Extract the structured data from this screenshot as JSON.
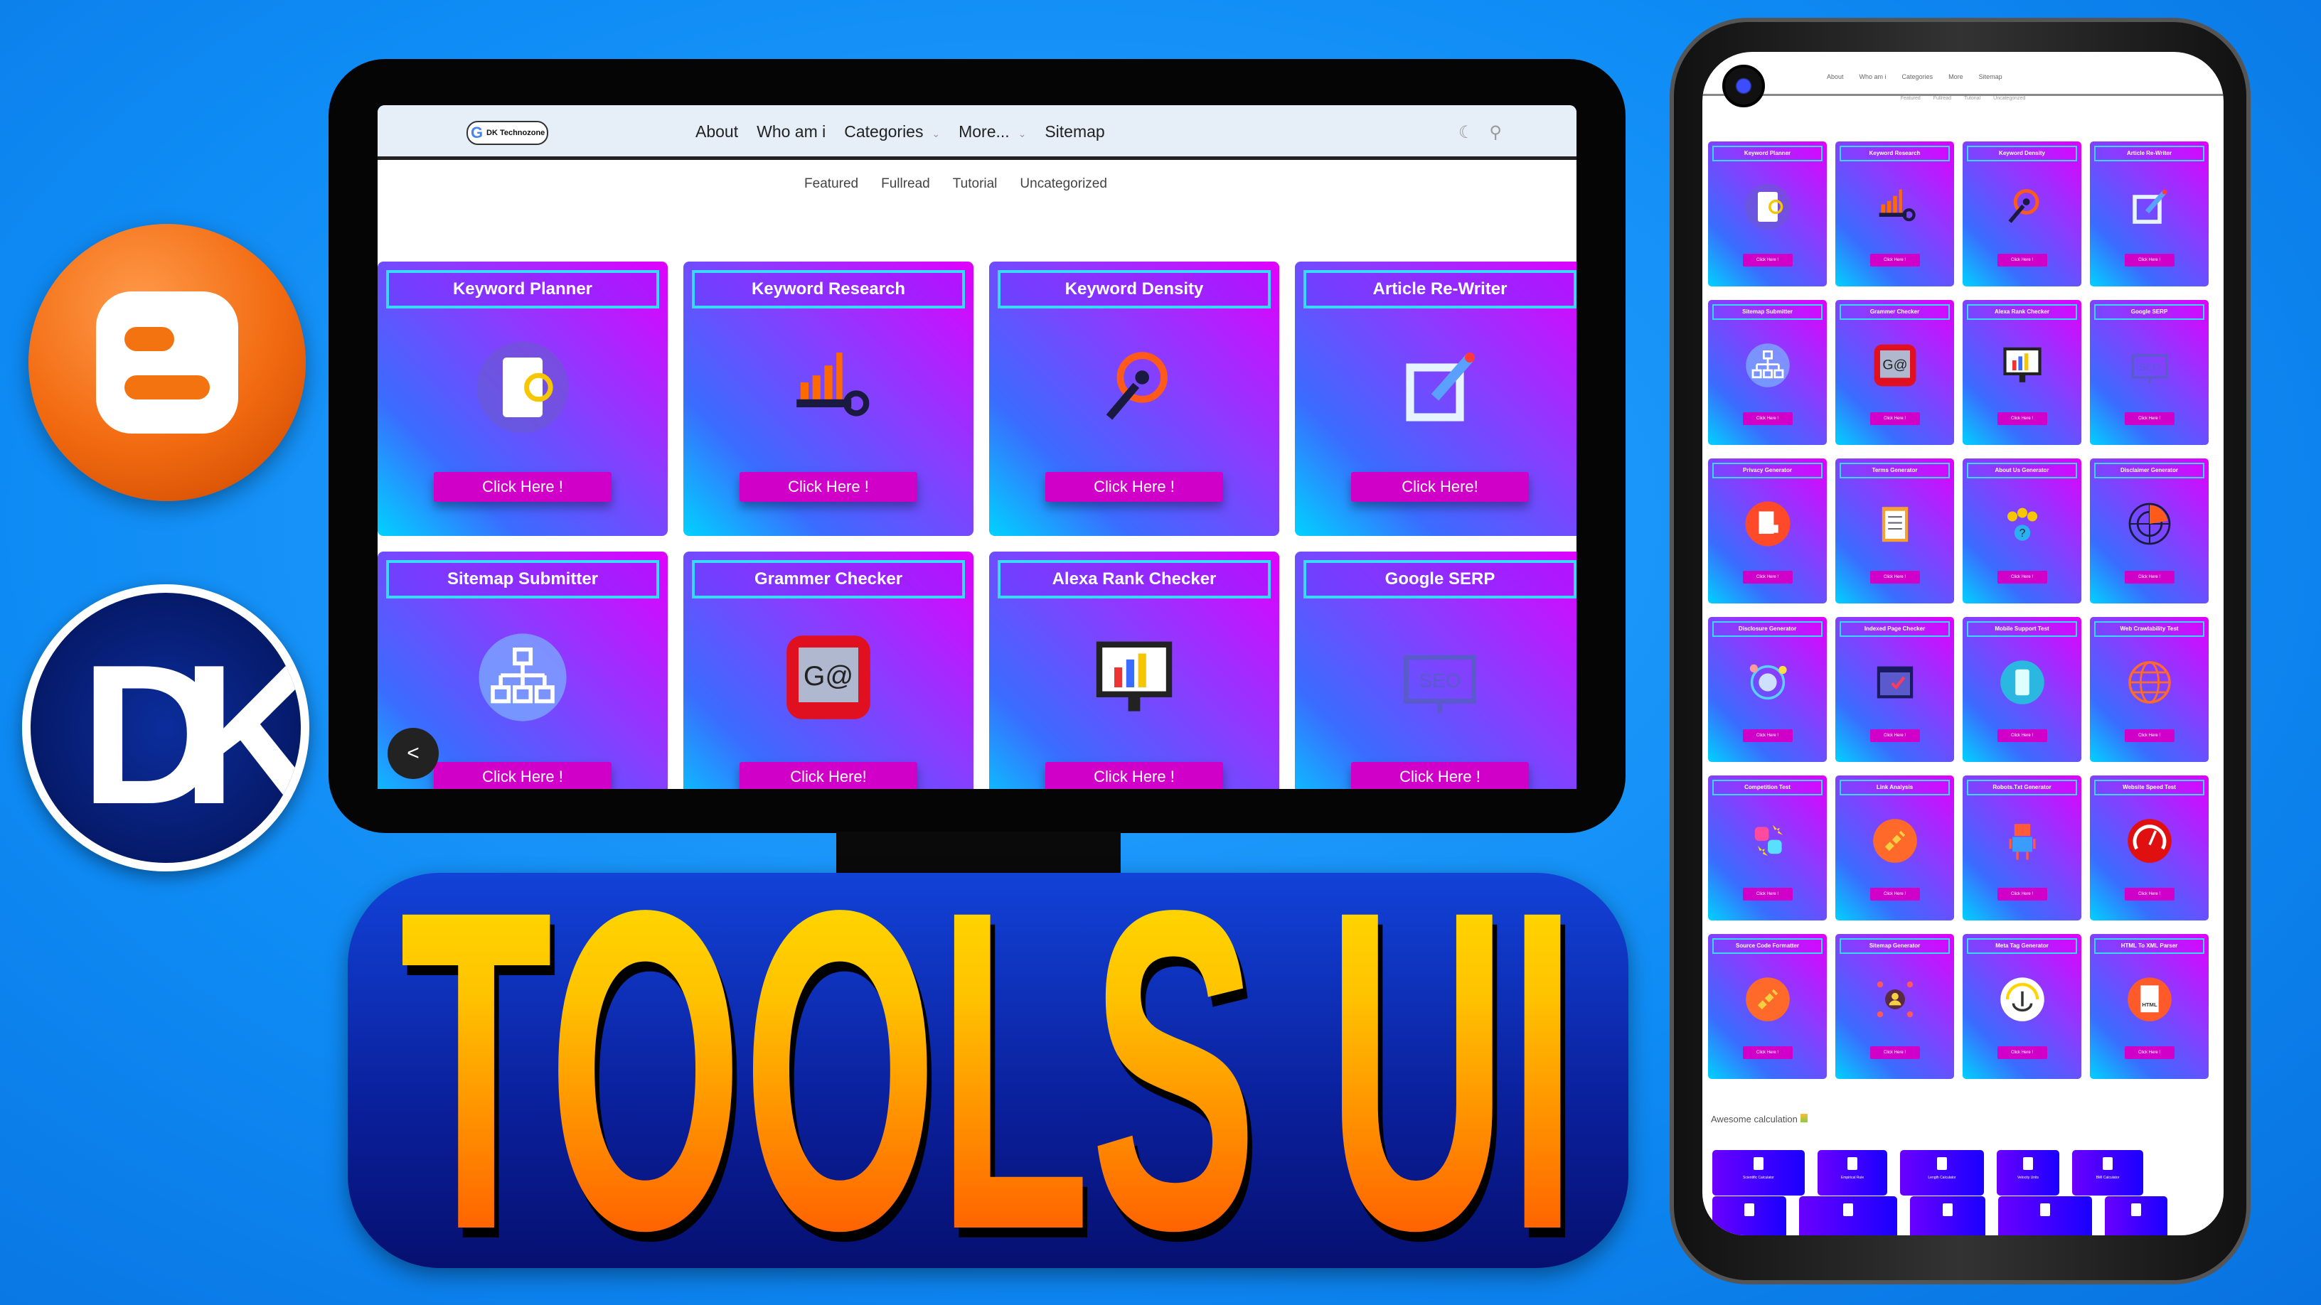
{
  "colors": {
    "background": "#0f8cf5",
    "card_gradient_start": "#e000ff",
    "card_gradient_end": "#00d2ff",
    "button": "#d000c8",
    "title_border": "#39d8ff",
    "blogger": "#f26a10"
  },
  "logos": {
    "blogger": "B",
    "dk": "DK"
  },
  "tablet": {
    "logo_text": "DK Technozone",
    "nav": [
      {
        "label": "About"
      },
      {
        "label": "Who am i"
      },
      {
        "label": "Categories",
        "dropdown": true
      },
      {
        "label": "More...",
        "dropdown": true
      },
      {
        "label": "Sitemap"
      }
    ],
    "header_icons": [
      "dark-mode-icon",
      "search-icon"
    ],
    "subnav": [
      "Featured",
      "Fullread",
      "Tutorial",
      "Uncategorized"
    ],
    "cards": [
      {
        "title": "Keyword Planner",
        "icon": "keyword-planner-icon",
        "button": "Click Here !"
      },
      {
        "title": "Keyword Research",
        "icon": "keyword-research-icon",
        "button": "Click Here !"
      },
      {
        "title": "Keyword Density",
        "icon": "keyword-density-icon",
        "button": "Click Here !"
      },
      {
        "title": "Article Re-Writer",
        "icon": "article-rewriter-icon",
        "button": "Click Here!"
      },
      {
        "title": "Sitemap Submitter",
        "icon": "sitemap-icon",
        "button": "Click Here !"
      },
      {
        "title": "Grammer Checker",
        "icon": "grammar-icon",
        "button": "Click Here!"
      },
      {
        "title": "Alexa Rank Checker",
        "icon": "rank-chart-icon",
        "button": "Click Here !"
      },
      {
        "title": "Google SERP",
        "icon": "seo-monitor-icon",
        "button": "Click Here !"
      }
    ],
    "share_icon": "share-icon"
  },
  "banner": {
    "title": "TOOLS UI"
  },
  "phone": {
    "nav": [
      "About",
      "Who am i",
      "Categories",
      "More",
      "Sitemap"
    ],
    "subnav": [
      "Featured",
      "Fullread",
      "Tutorial",
      "Uncategorized"
    ],
    "button_label": "Click Here !",
    "cards": [
      {
        "title": "Keyword Planner",
        "icon": "keyword-planner-icon"
      },
      {
        "title": "Keyword Research",
        "icon": "keyword-research-icon"
      },
      {
        "title": "Keyword Density",
        "icon": "keyword-density-icon"
      },
      {
        "title": "Article Re-Writer",
        "icon": "article-rewriter-icon"
      },
      {
        "title": "Sitemap Submitter",
        "icon": "sitemap-icon"
      },
      {
        "title": "Grammer Checker",
        "icon": "grammar-icon"
      },
      {
        "title": "Alexa Rank Checker",
        "icon": "rank-chart-icon"
      },
      {
        "title": "Google SERP",
        "icon": "seo-monitor-icon"
      },
      {
        "title": "Privacy Generator",
        "icon": "privacy-icon"
      },
      {
        "title": "Terms Generator",
        "icon": "clipboard-icon"
      },
      {
        "title": "About Us Generator",
        "icon": "team-icon"
      },
      {
        "title": "Disclaimer Generator",
        "icon": "radar-icon"
      },
      {
        "title": "Disclosure Generator",
        "icon": "megaphone-icon"
      },
      {
        "title": "Indexed Page Checker",
        "icon": "browser-check-icon"
      },
      {
        "title": "Mobile Support Test",
        "icon": "mobile-icon"
      },
      {
        "title": "Web Crawlability Test",
        "icon": "globe-icon"
      },
      {
        "title": "Competition Test",
        "icon": "competition-icon"
      },
      {
        "title": "Link Analysis",
        "icon": "link-icon"
      },
      {
        "title": "Robots.Txt Generator",
        "icon": "robot-icon"
      },
      {
        "title": "Website Speed Test",
        "icon": "speedometer-icon"
      },
      {
        "title": "Source Code Formatter",
        "icon": "link-icon"
      },
      {
        "title": "Sitemap Generator",
        "icon": "user-network-icon"
      },
      {
        "title": "Meta Tag Generator",
        "icon": "anchor-icon"
      },
      {
        "title": "HTML To XML Parser",
        "icon": "html-file-icon"
      }
    ],
    "section_title": "Awesome calculation",
    "calculators_row1": [
      "Scientific Calculator",
      "Empirical Rule",
      "Length Calculator",
      "Velocity Units",
      "BMI Calculator"
    ],
    "calculators_row2": [
      "",
      "",
      "",
      "",
      ""
    ]
  }
}
